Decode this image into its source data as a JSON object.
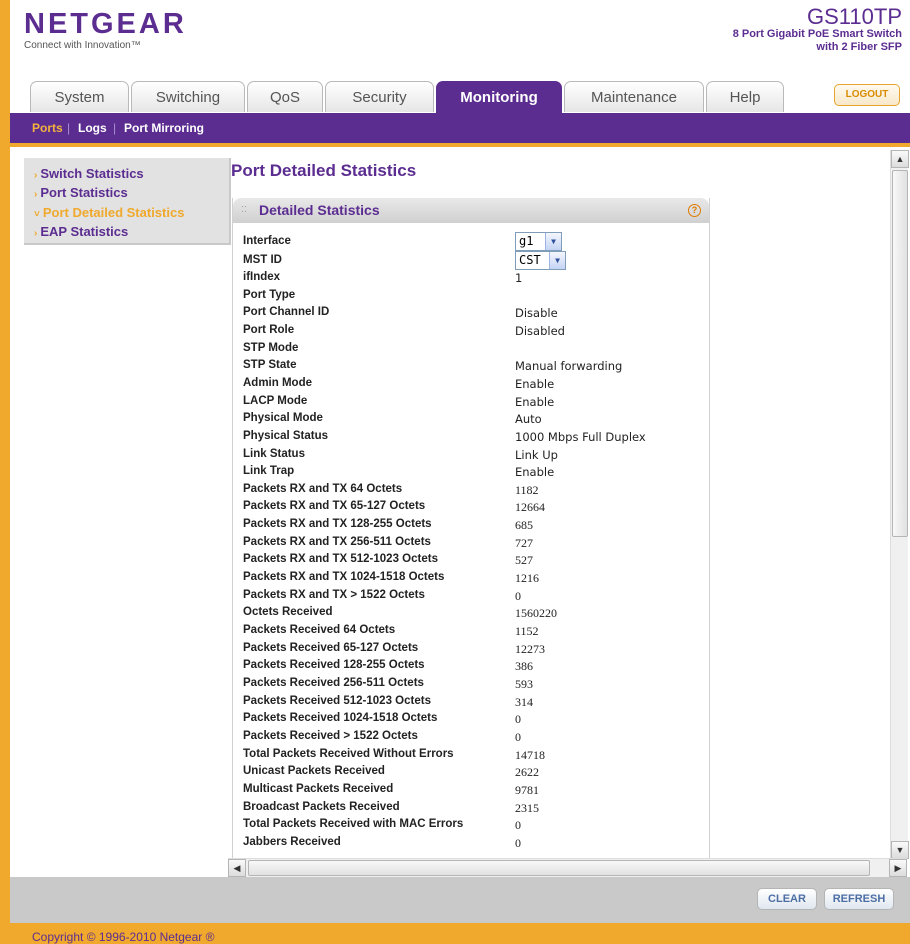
{
  "header": {
    "brand": "NETGEAR",
    "tagline": "Connect with Innovation™",
    "model": "GS110TP",
    "model_desc_1": "8 Port Gigabit PoE Smart Switch",
    "model_desc_2": "with 2 Fiber SFP"
  },
  "tabs": [
    "System",
    "Switching",
    "QoS",
    "Security",
    "Monitoring",
    "Maintenance",
    "Help"
  ],
  "active_tab": "Monitoring",
  "logout_label": "LOGOUT",
  "subnav": {
    "ports": "Ports",
    "logs": "Logs",
    "mirroring": "Port Mirroring",
    "sep": "|"
  },
  "leftmenu": [
    "Switch Statistics",
    "Port Statistics",
    "Port Detailed Statistics",
    "EAP Statistics"
  ],
  "page_title": "Port Detailed Statistics",
  "panel_title": "Detailed Statistics",
  "help_icon": "?",
  "interface": {
    "label": "Interface",
    "value": "g1"
  },
  "mstid": {
    "label": "MST ID",
    "value": "CST"
  },
  "rows": [
    {
      "label": "ifIndex",
      "value": "1"
    },
    {
      "label": "Port Type",
      "value": ""
    },
    {
      "label": "Port Channel ID",
      "value": "Disable"
    },
    {
      "label": "Port Role",
      "value": "Disabled"
    },
    {
      "label": "STP Mode",
      "value": ""
    },
    {
      "label": "STP State",
      "value": "Manual forwarding"
    },
    {
      "label": "Admin Mode",
      "value": "Enable"
    },
    {
      "label": "LACP Mode",
      "value": "Enable"
    },
    {
      "label": "Physical Mode",
      "value": "Auto"
    },
    {
      "label": "Physical Status",
      "value": "1000 Mbps Full Duplex"
    },
    {
      "label": "Link Status",
      "value": "Link Up"
    },
    {
      "label": "Link Trap",
      "value": "Enable"
    },
    {
      "label": "Packets RX and TX 64 Octets",
      "value": "1182"
    },
    {
      "label": "Packets RX and TX 65-127 Octets",
      "value": "12664"
    },
    {
      "label": "Packets RX and TX 128-255 Octets",
      "value": "685"
    },
    {
      "label": "Packets RX and TX 256-511 Octets",
      "value": "727"
    },
    {
      "label": "Packets RX and TX 512-1023 Octets",
      "value": "527"
    },
    {
      "label": "Packets RX and TX 1024-1518 Octets",
      "value": "1216"
    },
    {
      "label": "Packets RX and TX > 1522 Octets",
      "value": "0"
    },
    {
      "label": "Octets Received",
      "value": "1560220"
    },
    {
      "label": "Packets Received 64 Octets",
      "value": "1152"
    },
    {
      "label": "Packets Received 65-127 Octets",
      "value": "12273"
    },
    {
      "label": "Packets Received 128-255 Octets",
      "value": "386"
    },
    {
      "label": "Packets Received 256-511 Octets",
      "value": "593"
    },
    {
      "label": "Packets Received 512-1023 Octets",
      "value": "314"
    },
    {
      "label": "Packets Received 1024-1518 Octets",
      "value": "0"
    },
    {
      "label": "Packets Received > 1522 Octets",
      "value": "0"
    },
    {
      "label": "Total Packets Received Without Errors",
      "value": "14718"
    },
    {
      "label": "Unicast Packets Received",
      "value": "2622"
    },
    {
      "label": "Multicast Packets Received",
      "value": "9781"
    },
    {
      "label": "Broadcast Packets Received",
      "value": "2315"
    },
    {
      "label": "Total Packets Received with MAC Errors",
      "value": "0"
    },
    {
      "label": "Jabbers Received",
      "value": "0"
    }
  ],
  "buttons": {
    "clear": "CLEAR",
    "refresh": "REFRESH"
  },
  "copyright": "Copyright © 1996-2010 Netgear ®",
  "colors": {
    "brand_purple": "#5c2d91",
    "accent_orange": "#f0a92c"
  }
}
